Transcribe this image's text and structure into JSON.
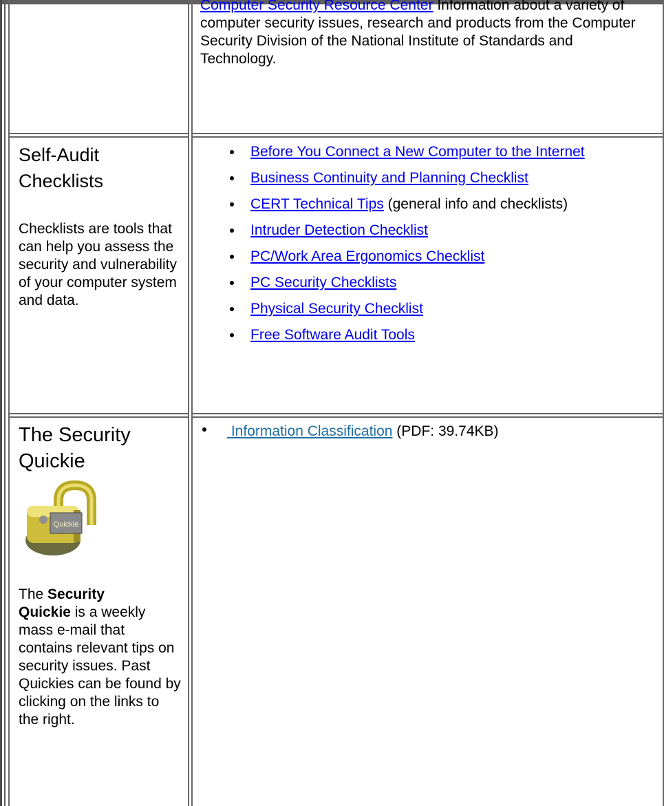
{
  "intro": {
    "link_text": "Computer Security Resource Center",
    "description": "Information about a variety of computer security issues, research and products from the Computer Security Division of the National Institute of Standards and Technology."
  },
  "self_audit": {
    "heading_line1": "Self-Audit",
    "heading_line2": "Checklists",
    "description": "Checklists are tools that can help you assess the security and vulnerability of your computer system and data.",
    "links": [
      {
        "text": "Before You Connect a New Computer to the Internet",
        "suffix": ""
      },
      {
        "text": "Business Continuity and Planning Checklist",
        "suffix": ""
      },
      {
        "text": "CERT Technical Tips",
        "suffix": " (general info and checklists)"
      },
      {
        "text": "Intruder Detection Checklist",
        "suffix": ""
      },
      {
        "text": "PC/Work Area Ergonomics Checklist",
        "suffix": ""
      },
      {
        "text": "PC Security Checklists",
        "suffix": ""
      },
      {
        "text": "Physical Security Checklist",
        "suffix": ""
      },
      {
        "text": "Free Software Audit Tools",
        "suffix": ""
      }
    ]
  },
  "quickie": {
    "heading_line1": "The Security",
    "heading_line2": "Quickie",
    "logo_text": "Quickie",
    "desc_pre": "The ",
    "desc_bold1": "Security",
    "desc_bold2": "Quickie",
    "desc_post": " is a weekly mass e-mail that contains relevant tips on security issues. Past Quickies can be found by clicking on the links to the right.",
    "item_link": "Information Classification",
    "item_suffix": " (PDF: 39.74KB)"
  },
  "colors": {
    "link": "#0000ee",
    "link_alt": "#1f6fa4",
    "border": "#666666"
  }
}
